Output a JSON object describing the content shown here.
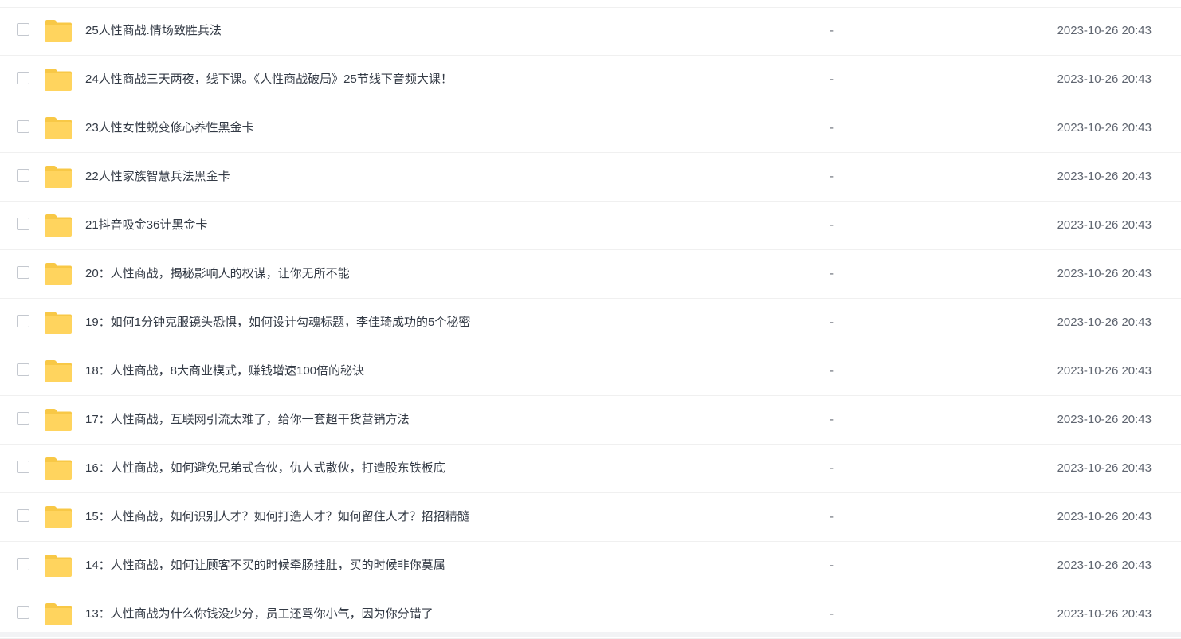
{
  "icons": {
    "checkbox": "checkbox-square",
    "folder": "folder-icon"
  },
  "colors": {
    "folder": "#ffd45e",
    "folder_tab": "#f8c846",
    "text": "#333a45",
    "muted": "#6b707a"
  },
  "files": [
    {
      "name": "25人性商战.情场致胜兵法",
      "size": "-",
      "modified": "2023-10-26 20:43"
    },
    {
      "name": "24人性商战三天两夜，线下课。《人性商战破局》25节线下音频大课！",
      "size": "-",
      "modified": "2023-10-26 20:43"
    },
    {
      "name": "23人性女性蜕变修心养性黑金卡",
      "size": "-",
      "modified": "2023-10-26 20:43"
    },
    {
      "name": "22人性家族智慧兵法黑金卡",
      "size": "-",
      "modified": "2023-10-26 20:43"
    },
    {
      "name": "21抖音吸金36计黑金卡",
      "size": "-",
      "modified": "2023-10-26 20:43"
    },
    {
      "name": "20：人性商战，揭秘影响人的权谋，让你无所不能",
      "size": "-",
      "modified": "2023-10-26 20:43"
    },
    {
      "name": "19：如何1分钟克服镜头恐惧，如何设计勾魂标题，李佳琦成功的5个秘密",
      "size": "-",
      "modified": "2023-10-26 20:43"
    },
    {
      "name": "18：人性商战，8大商业模式，赚钱增速100倍的秘诀",
      "size": "-",
      "modified": "2023-10-26 20:43"
    },
    {
      "name": "17：人性商战，互联网引流太难了，给你一套超干货营销方法",
      "size": "-",
      "modified": "2023-10-26 20:43"
    },
    {
      "name": "16：人性商战，如何避免兄弟式合伙，仇人式散伙，打造股东铁板底",
      "size": "-",
      "modified": "2023-10-26 20:43"
    },
    {
      "name": "15：人性商战，如何识别人才？如何打造人才？如何留住人才？招招精髓",
      "size": "-",
      "modified": "2023-10-26 20:43"
    },
    {
      "name": "14：人性商战，如何让顾客不买的时候牵肠挂肚，买的时候非你莫属",
      "size": "-",
      "modified": "2023-10-26 20:43"
    },
    {
      "name": "13：人性商战为什么你钱没少分，员工还骂你小气，因为你分错了",
      "size": "-",
      "modified": "2023-10-26 20:43"
    }
  ]
}
